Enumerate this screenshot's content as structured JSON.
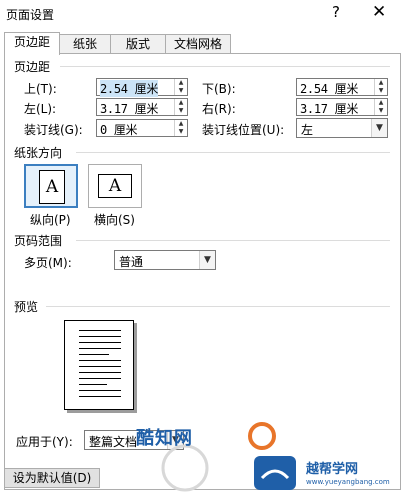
{
  "dialog": {
    "title": "页面设置",
    "help_glyph": "?",
    "close_glyph": "✕"
  },
  "tabs": [
    {
      "label": "页边距"
    },
    {
      "label": "纸张"
    },
    {
      "label": "版式"
    },
    {
      "label": "文档网格"
    }
  ],
  "margins": {
    "section_title": "页边距",
    "top_label": "上(T):",
    "top_value": "2.54 厘米",
    "bottom_label": "下(B):",
    "bottom_value": "2.54 厘米",
    "left_label": "左(L):",
    "left_value": "3.17 厘米",
    "right_label": "右(R):",
    "right_value": "3.17 厘米",
    "gutter_label": "装订线(G):",
    "gutter_value": "0 厘米",
    "gutter_pos_label": "装订线位置(U):",
    "gutter_pos_value": "左"
  },
  "orientation": {
    "section_title": "纸张方向",
    "portrait_label": "纵向(P)",
    "landscape_label": "横向(S)",
    "glyph": "A"
  },
  "pages": {
    "section_title": "页码范围",
    "multiple_label": "多页(M):",
    "multiple_value": "普通"
  },
  "preview": {
    "section_title": "预览"
  },
  "apply": {
    "label": "应用于(Y):",
    "value": "整篇文档"
  },
  "footer": {
    "default_button": "设为默认值(D)"
  },
  "watermark": {
    "text1": "酷知网",
    "text2": "越帮学网",
    "url": "www.yueyangbang.com"
  },
  "colors": {
    "accent": "#3c7fc0",
    "watermark_orange": "#e8752a",
    "watermark_blue": "#1f5fa8"
  }
}
